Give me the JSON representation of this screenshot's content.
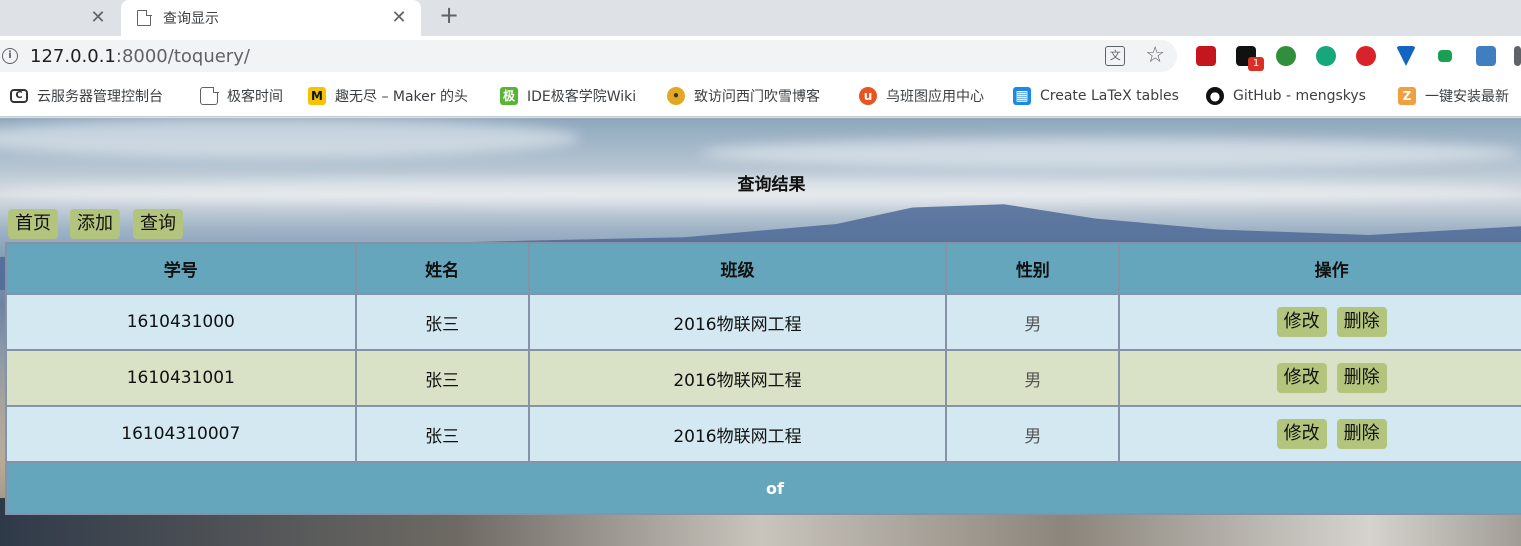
{
  "tabs": [
    {
      "title": ""
    },
    {
      "title": "查询显示"
    }
  ],
  "address": {
    "host": "127.0.0.1",
    "port_path": ":8000/toquery/"
  },
  "extensions": [
    {
      "name": "acrobat-extension-icon",
      "color": "#c4161c"
    },
    {
      "name": "notification-extension-icon",
      "color": "#111111",
      "badge": "1"
    },
    {
      "name": "globe-extension-icon",
      "color": "#2f8f3a"
    },
    {
      "name": "grammarly-extension-icon",
      "color": "#15a87a"
    },
    {
      "name": "adblock-plus-extension-icon",
      "color": "#d9232a"
    },
    {
      "name": "vpn-extension-icon",
      "color": "#1565c0"
    },
    {
      "name": "green-flag-extension-icon",
      "color": "#1aa052"
    },
    {
      "name": "s-extension-icon",
      "color": "#3f7fbf"
    }
  ],
  "bookmarks": [
    {
      "label": "云服务器管理控制台",
      "icon": "cloud-console-icon",
      "color": "#333333",
      "glyph": "C"
    },
    {
      "label": "极客时间",
      "icon": "page-icon",
      "color": "#ffffff",
      "glyph": ""
    },
    {
      "label": "趣无尽 – Maker 的头",
      "icon": "maker-icon",
      "color": "#f5c400",
      "glyph": "M"
    },
    {
      "label": "IDE极客学院Wiki",
      "icon": "wiki-icon",
      "color": "#58b534",
      "glyph": "极"
    },
    {
      "label": "致访问西门吹雪博客",
      "icon": "blog-icon",
      "color": "#e4a722",
      "glyph": "•"
    },
    {
      "label": "乌班图应用中心",
      "icon": "ubuntu-icon",
      "color": "#e95420",
      "glyph": "u"
    },
    {
      "label": "Create LaTeX tables",
      "icon": "table-icon",
      "color": "#1e88e5",
      "glyph": "▦"
    },
    {
      "label": "GitHub - mengskys",
      "icon": "github-icon",
      "color": "#111111",
      "glyph": "●"
    },
    {
      "label": "一键安装最新",
      "icon": "install-icon",
      "color": "#f0a040",
      "glyph": "Z"
    }
  ],
  "page": {
    "title": "查询结果",
    "nav": {
      "home": "首页",
      "add": "添加",
      "query": "查询"
    },
    "columns": [
      "学号",
      "姓名",
      "班级",
      "性别",
      "操作"
    ],
    "rows": [
      {
        "id": "1610431000",
        "name": "张三",
        "class": "2016物联网工程",
        "sex": "男",
        "edit": "修改",
        "delete": "删除"
      },
      {
        "id": "1610431001",
        "name": "张三",
        "class": "2016物联网工程",
        "sex": "男",
        "edit": "修改",
        "delete": "删除"
      },
      {
        "id": "16104310007",
        "name": "张三",
        "class": "2016物联网工程",
        "sex": "男",
        "edit": "修改",
        "delete": "删除"
      }
    ],
    "footer": "of"
  },
  "colors": {
    "header_bg": "#66a6bc",
    "row_odd": "#d3e8f0",
    "row_even": "#d9e2c6",
    "button_bg": "#b3c57c"
  }
}
